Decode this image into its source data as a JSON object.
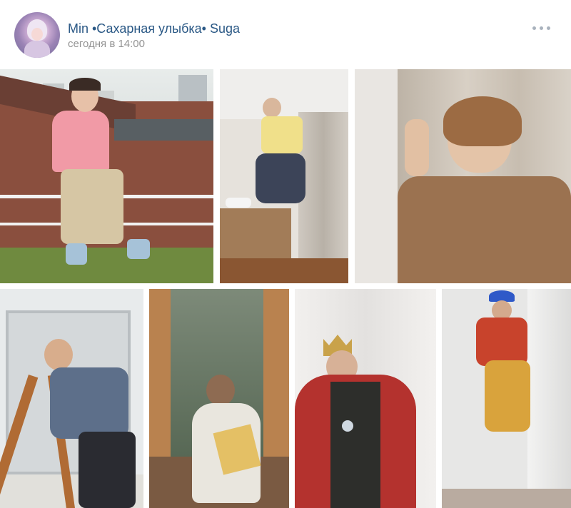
{
  "post": {
    "author": "Min •Сахарная улыбка• Suga",
    "time": "сегодня в 14:00",
    "more_icon": "more-horizontal-icon"
  },
  "colors": {
    "author_link": "#2a5885",
    "time_text": "#939393",
    "more_dots": "#a9b2bd"
  },
  "photos": [
    {
      "id": 1,
      "subject": "pink shirt jumping on rooftop rail"
    },
    {
      "id": 2,
      "subject": "mid-air leap in marble room"
    },
    {
      "id": 3,
      "subject": "laughing in brown jacket against wall"
    },
    {
      "id": 4,
      "subject": "leaning on wooden ladder by window"
    },
    {
      "id": 5,
      "subject": "seated facing open garden doors"
    },
    {
      "id": 6,
      "subject": "red feather boa with crown"
    },
    {
      "id": 7,
      "subject": "jumping with blue hat and red vest"
    }
  ]
}
